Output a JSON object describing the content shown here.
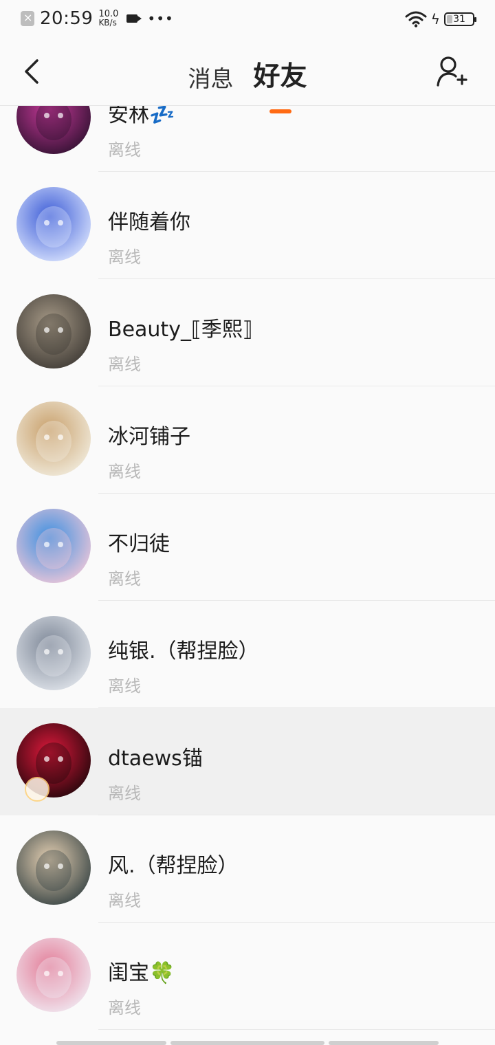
{
  "status_bar": {
    "time": "20:59",
    "net_speed_value": "10.0",
    "net_speed_unit": "KB/s",
    "dots": "•••",
    "battery": "31"
  },
  "header": {
    "tabs": [
      {
        "label": "消息",
        "active": false
      },
      {
        "label": "好友",
        "active": true
      }
    ],
    "accent_color": "#ff6a13"
  },
  "friends": [
    {
      "name": "安林💤",
      "status": "离线",
      "avatar_colors": [
        "#2a0f2c",
        "#c83a9a"
      ]
    },
    {
      "name": "伴随着你",
      "status": "离线",
      "avatar_colors": [
        "#dfe8ff",
        "#3b5bd6"
      ]
    },
    {
      "name": "Beauty_⟦季熙⟧",
      "status": "离线",
      "avatar_colors": [
        "#3a3631",
        "#a89b88"
      ]
    },
    {
      "name": "冰河铺子",
      "status": "离线",
      "avatar_colors": [
        "#f3efe2",
        "#c89f6a"
      ]
    },
    {
      "name": "不归徒",
      "status": "离线",
      "avatar_colors": [
        "#f6c9d8",
        "#3a8fe0"
      ]
    },
    {
      "name": "纯银.（帮捏脸）",
      "status": "离线",
      "avatar_colors": [
        "#e4e8ee",
        "#7c8696"
      ]
    },
    {
      "name": "dtaews锚",
      "status": "离线",
      "avatar_colors": [
        "#1a0508",
        "#e0193c"
      ]
    },
    {
      "name": "风.（帮捏脸）",
      "status": "离线",
      "avatar_colors": [
        "#2f3d3f",
        "#e8d2b4"
      ]
    },
    {
      "name": "闺宝🍀",
      "status": "离线",
      "avatar_colors": [
        "#f1edf5",
        "#e37c97"
      ]
    }
  ]
}
